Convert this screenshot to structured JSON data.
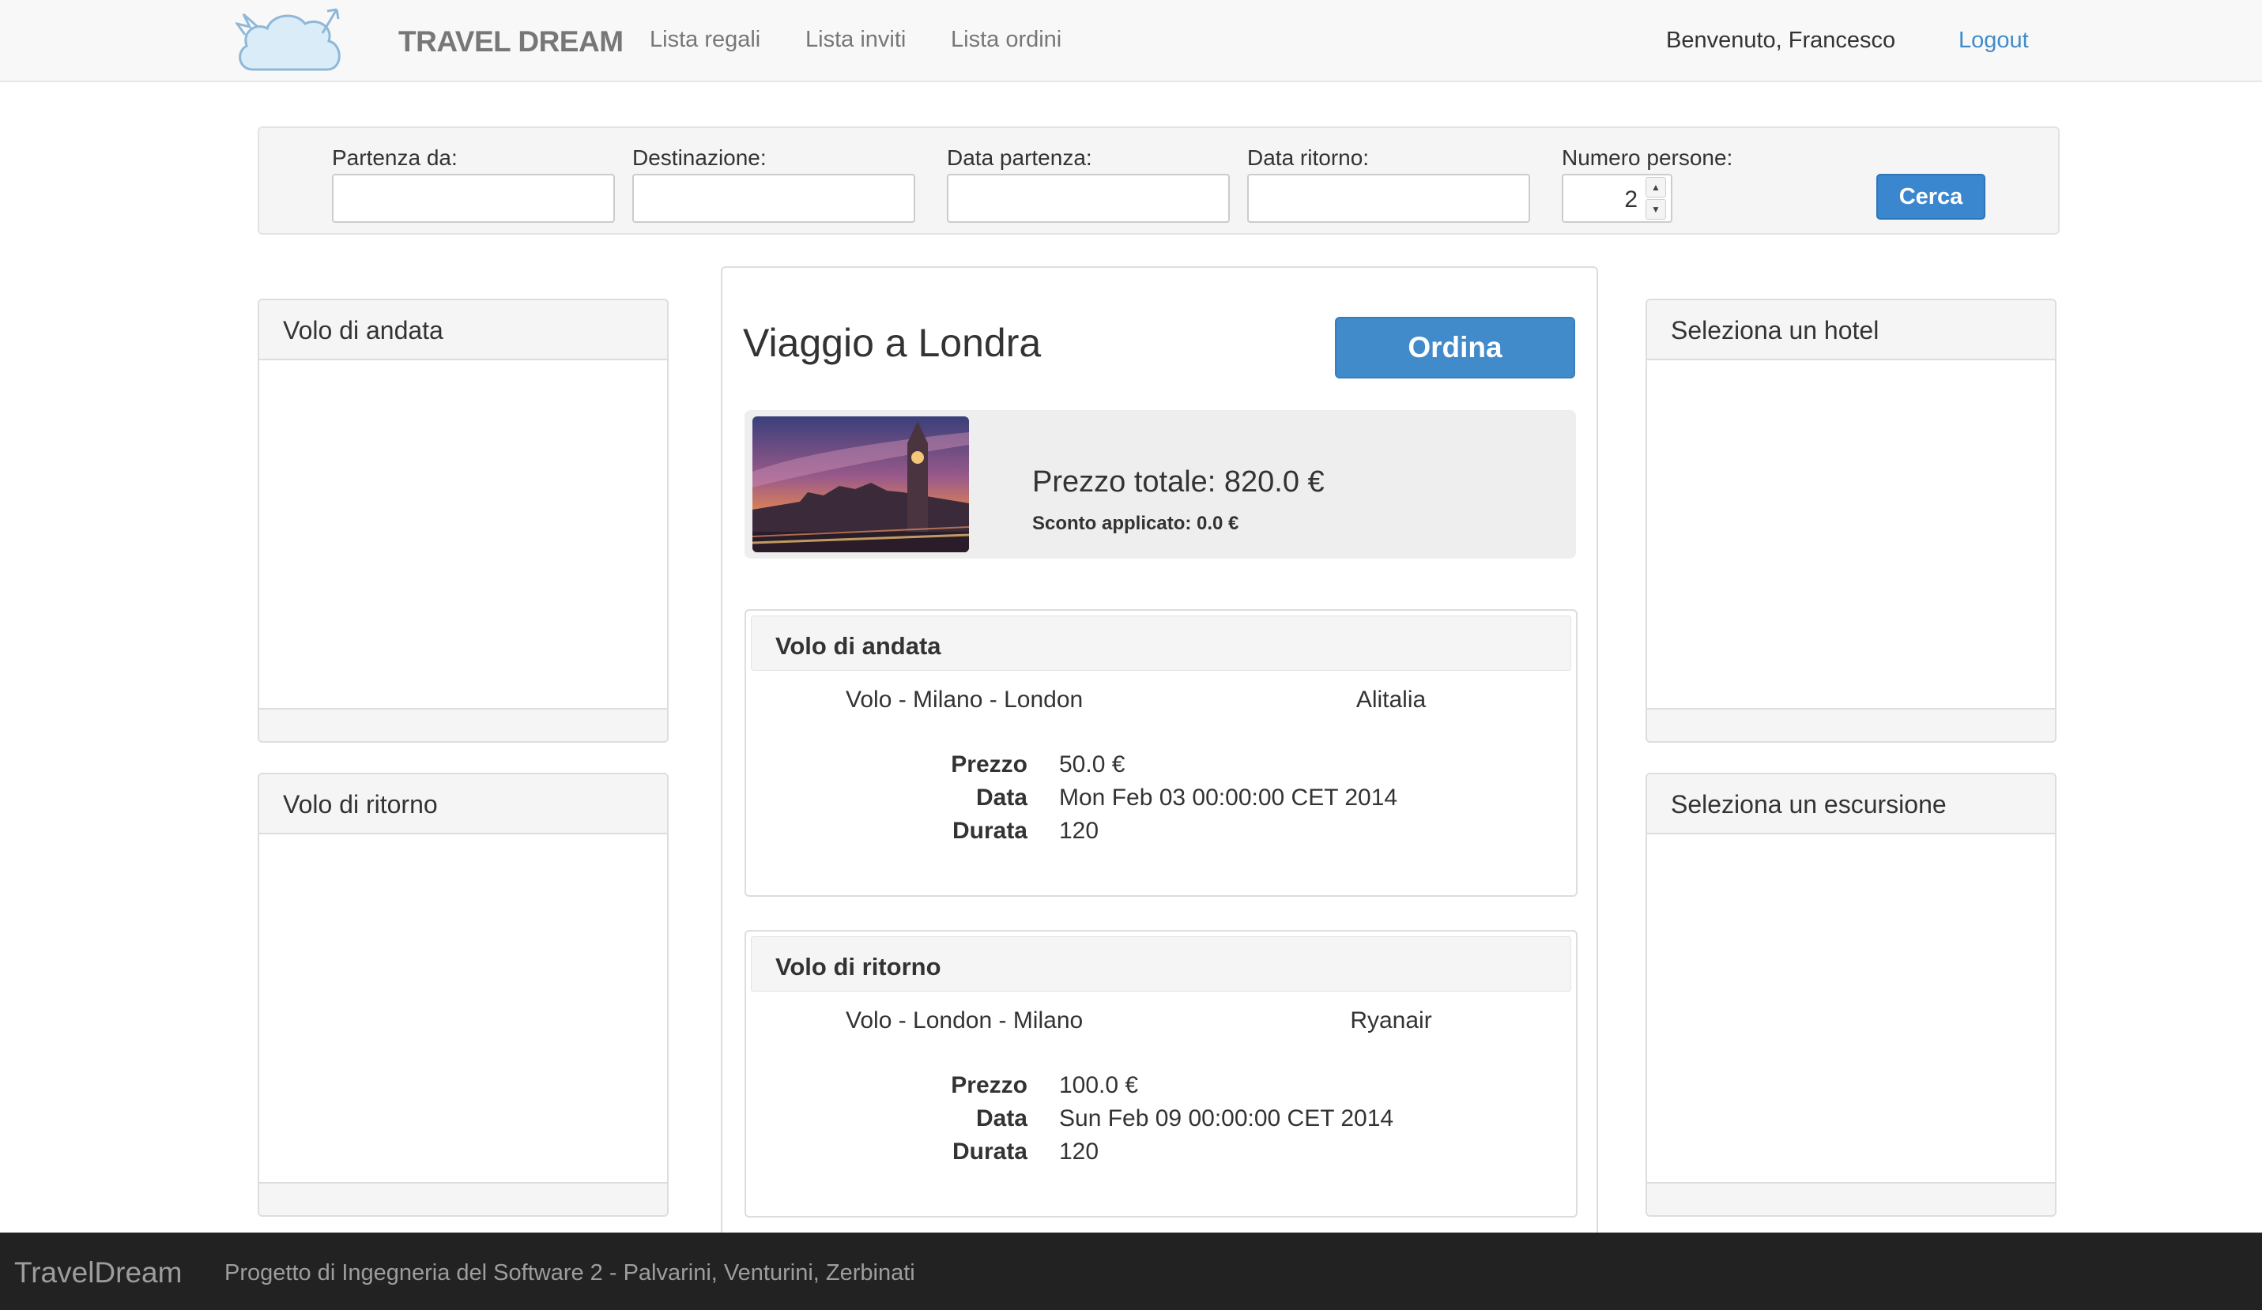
{
  "navbar": {
    "brand": "TRAVEL DREAM",
    "links": [
      "Lista regali",
      "Lista inviti",
      "Lista ordini"
    ],
    "welcome": "Benvenuto, Francesco",
    "logout": "Logout"
  },
  "search": {
    "labels": {
      "from": "Partenza da:",
      "destination": "Destinazione:",
      "departure_date": "Data partenza:",
      "return_date": "Data ritorno:",
      "people": "Numero persone:"
    },
    "values": {
      "from": "",
      "destination": "",
      "departure_date": "",
      "return_date": "",
      "people": "2"
    },
    "button": "Cerca"
  },
  "left_panels": {
    "outbound": {
      "title": "Volo di andata"
    },
    "return": {
      "title": "Volo di ritorno"
    }
  },
  "right_panels": {
    "hotel": {
      "title": "Seleziona un hotel"
    },
    "excursion": {
      "title": "Seleziona un escursione"
    }
  },
  "trip": {
    "title": "Viaggio a Londra",
    "order_button": "Ordina",
    "total_price": "Prezzo totale: 820.0 €",
    "discount": "Sconto applicato: 0.0 €"
  },
  "flights": {
    "outbound": {
      "header": "Volo di andata",
      "route": "Volo - Milano - London",
      "airline": "Alitalia",
      "price_label": "Prezzo",
      "price": "50.0 €",
      "date_label": "Data",
      "date": "Mon Feb 03 00:00:00 CET 2014",
      "duration_label": "Durata",
      "duration": "120"
    },
    "return": {
      "header": "Volo di ritorno",
      "route": "Volo - London - Milano",
      "airline": "Ryanair",
      "price_label": "Prezzo",
      "price": "100.0 €",
      "date_label": "Data",
      "date": "Sun Feb 09 00:00:00 CET 2014",
      "duration_label": "Durata",
      "duration": "120"
    }
  },
  "footer": {
    "brand": "TravelDream",
    "text": "Progetto di Ingegneria del Software 2 - Palvarini, Venturini, Zerbinati"
  },
  "colors": {
    "primary": "#428bca",
    "navbar_bg": "#f8f8f8",
    "footer_bg": "#222222",
    "panel_head_bg": "#f5f5f5",
    "logo_fill": "#d9ecf8"
  },
  "icons": {
    "logo": "winged-cloud-logo",
    "spinner": "up-down-arrows-icon",
    "thumbnail": "big-ben-photo"
  }
}
